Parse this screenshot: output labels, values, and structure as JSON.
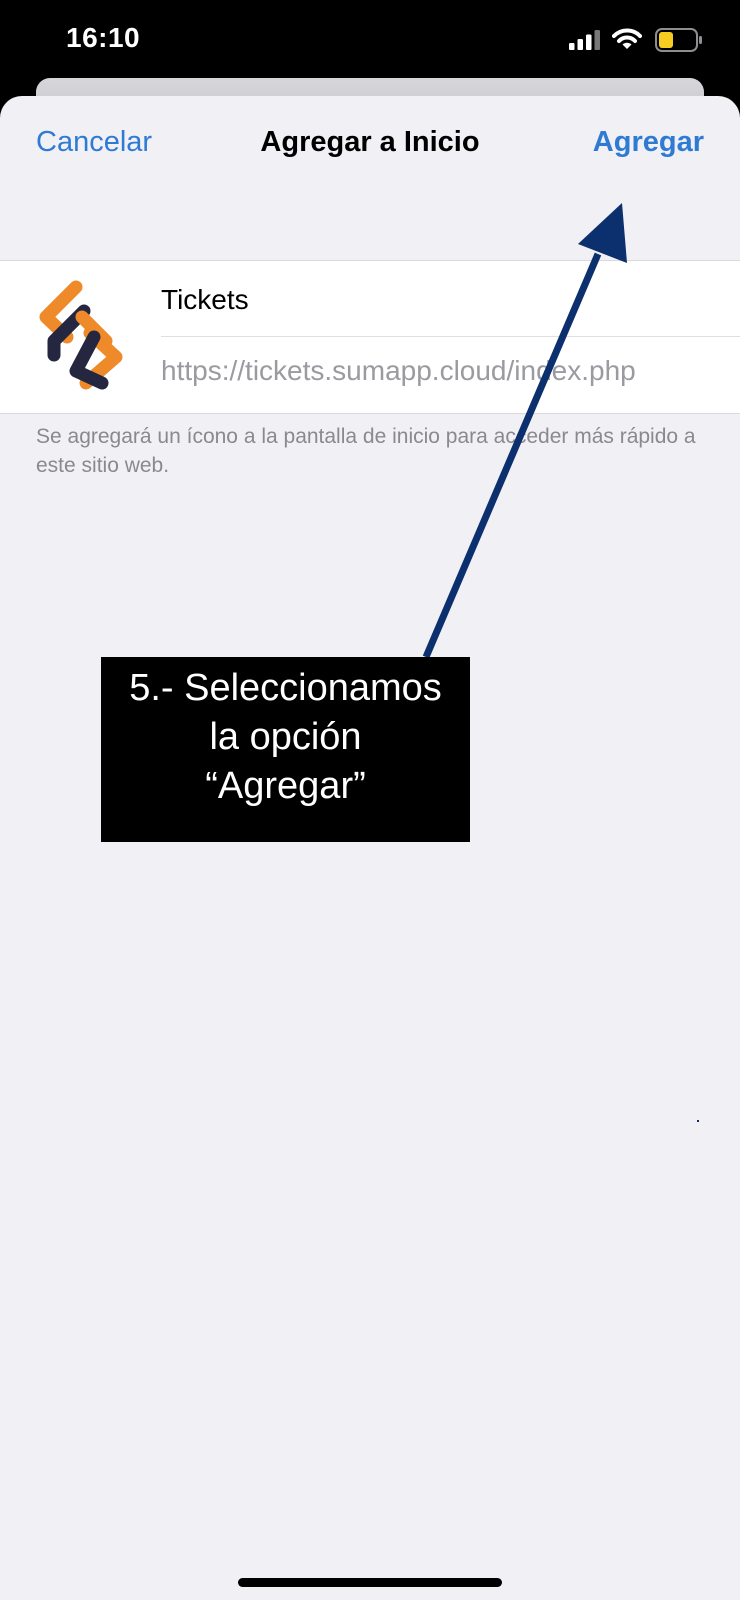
{
  "status_bar": {
    "time": "16:10",
    "icons": [
      "signal-icon",
      "wifi-icon",
      "battery-icon"
    ],
    "battery_color": "#f5cc1f"
  },
  "nav": {
    "cancel_label": "Cancelar",
    "title": "Agregar a Inicio",
    "add_label": "Agregar"
  },
  "shortcut": {
    "name": "Tickets",
    "url": "https://tickets.sumapp.cloud/index.php",
    "icon": "sumapp-logo-icon"
  },
  "footnote": "Se agregará un ícono a la pantalla de inicio para acceder más rápido a este sitio web.",
  "annotation": {
    "lines": [
      "5.- Seleccionamos",
      "la opción",
      "“Agregar”"
    ],
    "arrow_color": "#0c2f6e"
  },
  "colors": {
    "accent": "#2f7bd3",
    "sheet_background": "#f0f0f5",
    "logo_orange": "#ef8a2b",
    "logo_navy": "#25263f"
  }
}
